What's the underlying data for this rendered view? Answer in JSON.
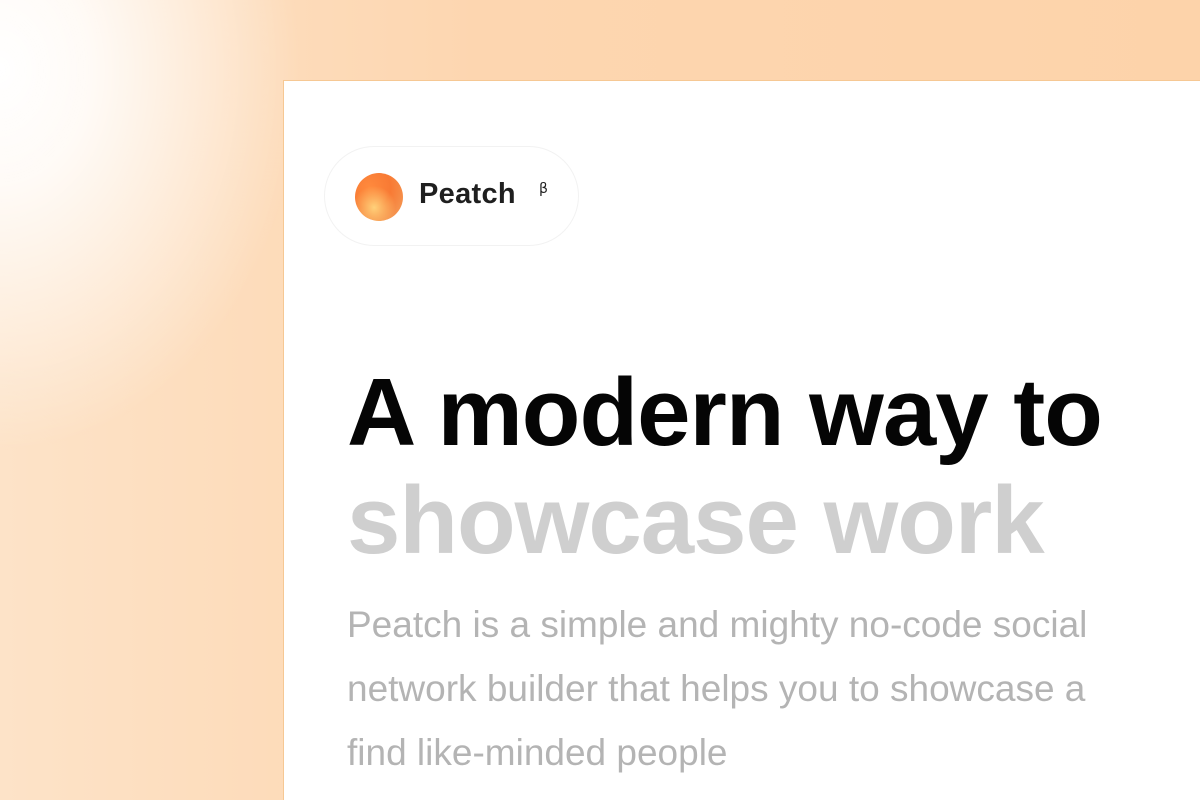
{
  "brand": {
    "name": "Peatch",
    "badge": "β",
    "logo_icon": "orange-gradient-orb-icon"
  },
  "hero": {
    "headline_line1": "A modern way to",
    "headline_line2": "showcase work",
    "description_lines": [
      "Peatch is a simple and mighty no-code social",
      "network builder that helps you to showcase a",
      "find like-minded people"
    ]
  },
  "colors": {
    "accent": "#f87a34",
    "headline_primary": "#050505",
    "headline_muted": "#cfcfcf",
    "body_text": "#b4b4b4",
    "background_peach": "#fdd6b0"
  }
}
